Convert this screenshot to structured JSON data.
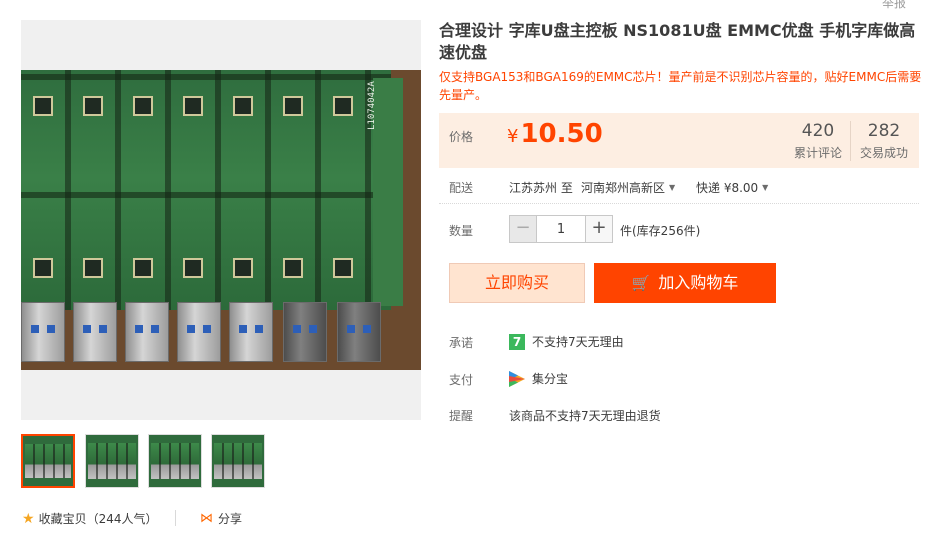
{
  "header": {
    "report_label": "举报"
  },
  "product": {
    "title": "合理设计 字库U盘主控板 NS1081U盘 EMMC优盘 手机字库做高速优盘",
    "subtitle": "仅支持BGA153和BGA169的EMMC芯片！量产前是不识别芯片容量的，贴好EMMC后需要先量产。",
    "image_board_label": "L1074042A"
  },
  "price": {
    "label": "价格",
    "currency": "¥",
    "value": "10.50",
    "reviews_count": "420",
    "reviews_label": "累计评论",
    "sales_count": "282",
    "sales_label": "交易成功"
  },
  "shipping": {
    "label": "配送",
    "from": "江苏苏州 至",
    "to": "河南郑州高新区",
    "method": "快递 ¥8.00"
  },
  "quantity": {
    "label": "数量",
    "value": "1",
    "minus": "−",
    "plus": "+",
    "stock": "件(库存256件)"
  },
  "actions": {
    "buy_now": "立即购买",
    "add_to_cart": "加入购物车"
  },
  "services": {
    "promise_label": "承诺",
    "promise_badge": "7",
    "promise_text": "不支持7天无理由",
    "pay_label": "支付",
    "pay_text": "集分宝",
    "notice_label": "提醒",
    "notice_text": "该商品不支持7天无理由退货"
  },
  "footer": {
    "favorite": "收藏宝贝（244人气）",
    "share": "分享"
  },
  "colors": {
    "accent": "#ff4400",
    "price_bg": "#fdeee2",
    "buy_bg": "#ffe4d0",
    "badge_green": "#3bb85c"
  },
  "icons": {
    "cart": "shopping-cart-icon",
    "star": "star-icon",
    "share": "share-icon",
    "seven_day": "seven-day-badge-icon",
    "pay": "jifenbao-icon"
  }
}
